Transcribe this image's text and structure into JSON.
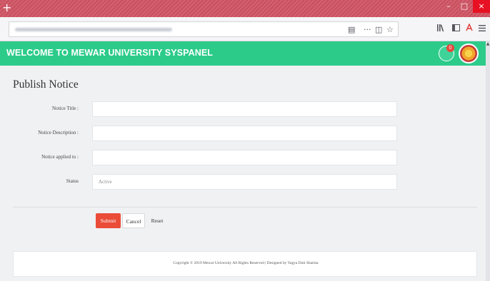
{
  "browser": {
    "new_tab_symbol": "+",
    "window_controls": {
      "minimize": "–",
      "maximize": "□",
      "close": "×"
    },
    "nav_icons": [
      "reader-view-icon",
      "more-icon",
      "pocket-icon",
      "bookmark-star-icon",
      "library-icon",
      "sidebar-icon",
      "pdf-icon",
      "menu-icon"
    ],
    "nav_glyphs": {
      "reader": "▤",
      "more": "···",
      "pocket": "◫",
      "star": "☆",
      "library": "𝐈𝐈\\",
      "sidebar": "◧",
      "pdf": "ᴀ",
      "menu": "☰"
    }
  },
  "header": {
    "brand_title": "WELCOME TO MEWAR UNIVERSITY SYSPANEL",
    "notification_count": "0",
    "accent_color": "#2ccb8a"
  },
  "page": {
    "title": "Publish Notice"
  },
  "form": {
    "fields": [
      {
        "label": "Notice Title :",
        "value": ""
      },
      {
        "label": "Notice Description :",
        "value": ""
      },
      {
        "label": "Notice applied to :",
        "value": ""
      },
      {
        "label": "Status",
        "value": "Active"
      }
    ],
    "buttons": {
      "submit": "Submit",
      "cancel": "Cancel",
      "reset": "Reset"
    },
    "submit_color": "#ea4c37"
  },
  "footer": {
    "text": "Copyright © 2019 Mewar University All Rights Reserved | Designed by Yagya Dutt Sharma"
  }
}
